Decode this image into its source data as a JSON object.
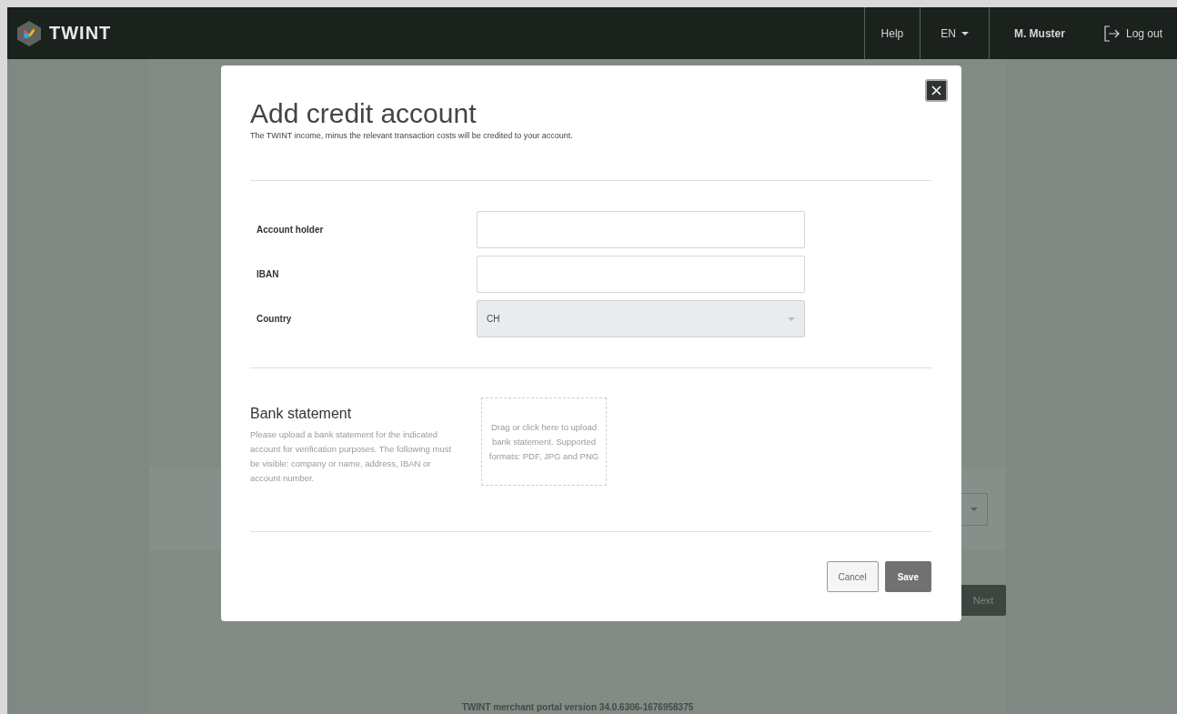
{
  "header": {
    "brand": "TWINT",
    "nav": [
      {
        "kind": "link",
        "label": "Help"
      },
      {
        "kind": "dropdown",
        "label": "EN"
      },
      {
        "kind": "user",
        "label": "M. Muster"
      },
      {
        "kind": "logout",
        "label": "Log out"
      }
    ]
  },
  "background": {
    "next_button": "Next",
    "footer": "TWINT merchant portal version 34.0.6306-1676958375"
  },
  "dialog": {
    "title": "Add credit account",
    "subtitle": "The TWINT income, minus the relevant transaction costs will be credited to your account.",
    "fields": [
      {
        "kind": "text",
        "label": "Account holder"
      },
      {
        "kind": "text",
        "label": "IBAN"
      },
      {
        "kind": "select",
        "label": "Country",
        "value": "CH"
      }
    ],
    "bank_statement": {
      "title": "Bank statement",
      "description": "Please upload a bank statement for the indicated account for verification purposes. The following must be visible: company or name, address, IBAN or account number.",
      "dropzone": "Drag or click here to upload bank statement. Supported formats: PDF, JPG and PNG"
    },
    "buttons": [
      {
        "kind": "secondary",
        "label": "Cancel"
      },
      {
        "kind": "primary",
        "label": "Save"
      }
    ]
  }
}
